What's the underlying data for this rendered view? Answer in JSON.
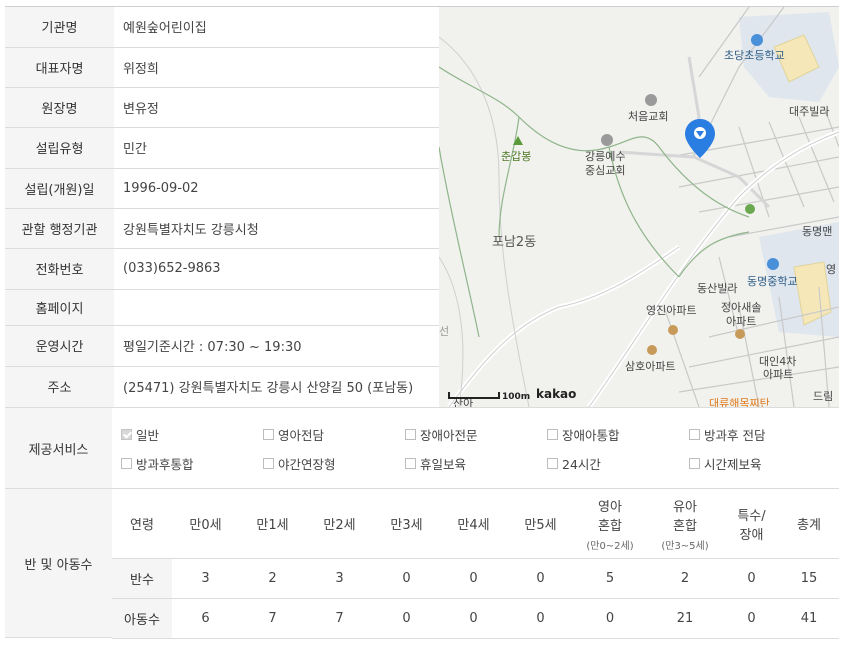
{
  "info": [
    {
      "label": "기관명",
      "value": "예원숲어린이집"
    },
    {
      "label": "대표자명",
      "value": "위정희"
    },
    {
      "label": "원장명",
      "value": "변유정"
    },
    {
      "label": "설립유형",
      "value": "민간"
    },
    {
      "label": "설립(개원)일",
      "value": "1996-09-02"
    },
    {
      "label": "관할 행정기관",
      "value": "강원특별자치도 강릉시청"
    },
    {
      "label": "전화번호",
      "value": "(033)652-9863"
    },
    {
      "label": "홈페이지",
      "value": ""
    },
    {
      "label": "운영시간",
      "value": "평일기준시간 : 07:30 ~ 19:30"
    },
    {
      "label": "주소",
      "value": "(25471) 강원특별자치도 강릉시 산양길 50 (포남동)"
    }
  ],
  "map": {
    "labels": {
      "school1": "초당초등학교",
      "church1": "처음교회",
      "villa1": "대주빌라",
      "peak": "춘갑봉",
      "church2a": "강릉예수",
      "church2b": "중심교회",
      "district": "포남2동",
      "dongmyeong": "동명맨",
      "yeong": "영",
      "dongsan": "동산빌라",
      "school2": "동명중학교",
      "yeongjin": "영진아파트",
      "jeonga1": "정아새솔",
      "jeonga2": "아파트",
      "daein1": "대인4차",
      "daein2": "아파트",
      "samho": "삼호아파트",
      "daeryu": "대류해목찌탄",
      "drim": "드림",
      "partial": "산아",
      "line": "선"
    },
    "scale": "100m",
    "logo": "kakao"
  },
  "services": {
    "label": "제공서비스",
    "items": [
      {
        "label": "일반",
        "checked": true
      },
      {
        "label": "영아전담",
        "checked": false
      },
      {
        "label": "장애아전문",
        "checked": false
      },
      {
        "label": "장애아통합",
        "checked": false
      },
      {
        "label": "방과후 전담",
        "checked": false
      },
      {
        "label": "방과후통합",
        "checked": false
      },
      {
        "label": "야간연장형",
        "checked": false
      },
      {
        "label": "휴일보육",
        "checked": false
      },
      {
        "label": "24시간",
        "checked": false
      },
      {
        "label": "시간제보육",
        "checked": false
      }
    ]
  },
  "classes": {
    "label": "반 및 아동수",
    "headers": [
      {
        "main": "연령",
        "main2": "",
        "sub": ""
      },
      {
        "main": "만0세",
        "main2": "",
        "sub": ""
      },
      {
        "main": "만1세",
        "main2": "",
        "sub": ""
      },
      {
        "main": "만2세",
        "main2": "",
        "sub": ""
      },
      {
        "main": "만3세",
        "main2": "",
        "sub": ""
      },
      {
        "main": "만4세",
        "main2": "",
        "sub": ""
      },
      {
        "main": "만5세",
        "main2": "",
        "sub": ""
      },
      {
        "main": "영아",
        "main2": "혼합",
        "sub": "(만0~2세)"
      },
      {
        "main": "유아",
        "main2": "혼합",
        "sub": "(만3~5세)"
      },
      {
        "main": "특수/",
        "main2": "장애",
        "sub": ""
      },
      {
        "main": "총계",
        "main2": "",
        "sub": ""
      }
    ],
    "rows": [
      {
        "label": "반수",
        "values": [
          "3",
          "2",
          "3",
          "0",
          "0",
          "0",
          "5",
          "2",
          "0",
          "15"
        ]
      },
      {
        "label": "아동수",
        "values": [
          "6",
          "7",
          "7",
          "0",
          "0",
          "0",
          "0",
          "21",
          "0",
          "41"
        ]
      }
    ]
  },
  "colors": {
    "marker": "#2a7de1",
    "poi_blue": "#2d5d86",
    "poi_green": "#4f7a26"
  },
  "icons": [
    "check-icon",
    "map-marker-icon",
    "school-icon",
    "church-icon",
    "mountain-icon",
    "apartment-icon"
  ]
}
